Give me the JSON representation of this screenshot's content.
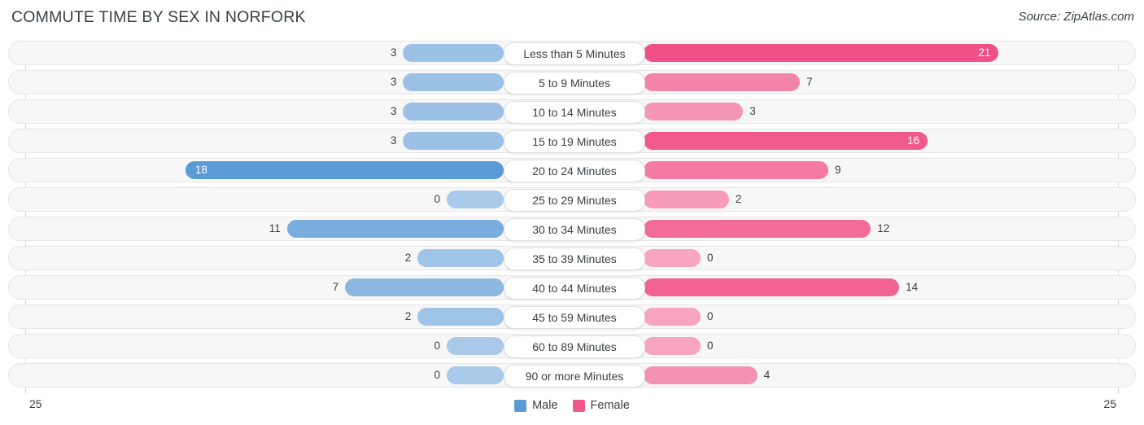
{
  "header": {
    "title": "COMMUTE TIME BY SEX IN NORFORK",
    "source": "Source: ZipAtlas.com"
  },
  "axis": {
    "left_tick": "25",
    "right_tick": "25"
  },
  "legend": {
    "items": [
      {
        "label": "Male",
        "color": "#5b9bd5"
      },
      {
        "label": "Female",
        "color": "#f0588b"
      }
    ]
  },
  "chart_data": {
    "type": "bar",
    "orientation": "horizontal-diverging",
    "title": "COMMUTE TIME BY SEX IN NORFORK",
    "xlabel": "",
    "ylabel": "",
    "xlim": [
      25,
      25
    ],
    "grid": false,
    "legend_position": "bottom-center",
    "categories": [
      "Less than 5 Minutes",
      "5 to 9 Minutes",
      "10 to 14 Minutes",
      "15 to 19 Minutes",
      "20 to 24 Minutes",
      "25 to 29 Minutes",
      "30 to 34 Minutes",
      "35 to 39 Minutes",
      "40 to 44 Minutes",
      "45 to 59 Minutes",
      "60 to 89 Minutes",
      "90 or more Minutes"
    ],
    "series": [
      {
        "name": "Male",
        "values": [
          3,
          3,
          3,
          3,
          18,
          0,
          11,
          2,
          7,
          2,
          0,
          0
        ]
      },
      {
        "name": "Female",
        "values": [
          21,
          7,
          3,
          16,
          9,
          2,
          12,
          0,
          14,
          0,
          0,
          4
        ]
      }
    ]
  },
  "rows": [
    {
      "category": "Less than 5 Minutes",
      "male": "3",
      "female": "21"
    },
    {
      "category": "5 to 9 Minutes",
      "male": "3",
      "female": "7"
    },
    {
      "category": "10 to 14 Minutes",
      "male": "3",
      "female": "3"
    },
    {
      "category": "15 to 19 Minutes",
      "male": "3",
      "female": "16"
    },
    {
      "category": "20 to 24 Minutes",
      "male": "18",
      "female": "9"
    },
    {
      "category": "25 to 29 Minutes",
      "male": "0",
      "female": "2"
    },
    {
      "category": "30 to 34 Minutes",
      "male": "11",
      "female": "12"
    },
    {
      "category": "35 to 39 Minutes",
      "male": "2",
      "female": "0"
    },
    {
      "category": "40 to 44 Minutes",
      "male": "7",
      "female": "14"
    },
    {
      "category": "45 to 59 Minutes",
      "male": "2",
      "female": "0"
    },
    {
      "category": "60 to 89 Minutes",
      "male": "0",
      "female": "0"
    },
    {
      "category": "90 or more Minutes",
      "male": "0",
      "female": "4"
    }
  ]
}
